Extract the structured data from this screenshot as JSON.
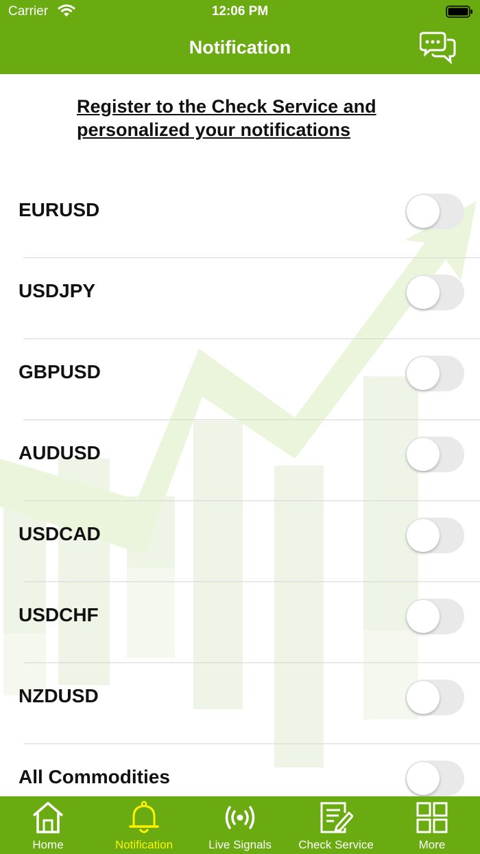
{
  "status_bar": {
    "carrier": "Carrier",
    "time": "12:06 PM"
  },
  "nav": {
    "title": "Notification",
    "chat_icon": "chat-bubbles-icon"
  },
  "register_link": "Register to the Check Service and personalized your notifications",
  "pairs": [
    {
      "label": "EURUSD",
      "enabled": false
    },
    {
      "label": "USDJPY",
      "enabled": false
    },
    {
      "label": "GBPUSD",
      "enabled": false
    },
    {
      "label": "AUDUSD",
      "enabled": false
    },
    {
      "label": "USDCAD",
      "enabled": false
    },
    {
      "label": "USDCHF",
      "enabled": false
    },
    {
      "label": "NZDUSD",
      "enabled": false
    },
    {
      "label": "All Commodities",
      "enabled": false
    }
  ],
  "tabs": [
    {
      "label": "Home",
      "icon": "home-icon",
      "active": false
    },
    {
      "label": "Notification",
      "icon": "bell-icon",
      "active": true
    },
    {
      "label": "Live Signals",
      "icon": "broadcast-icon",
      "active": false
    },
    {
      "label": "Check Service",
      "icon": "edit-note-icon",
      "active": false
    },
    {
      "label": "More",
      "icon": "grid-icon",
      "active": false
    }
  ],
  "colors": {
    "brand": "#6aab12",
    "active_tab": "#fff200",
    "toggle_off": "#e9e9ea"
  }
}
